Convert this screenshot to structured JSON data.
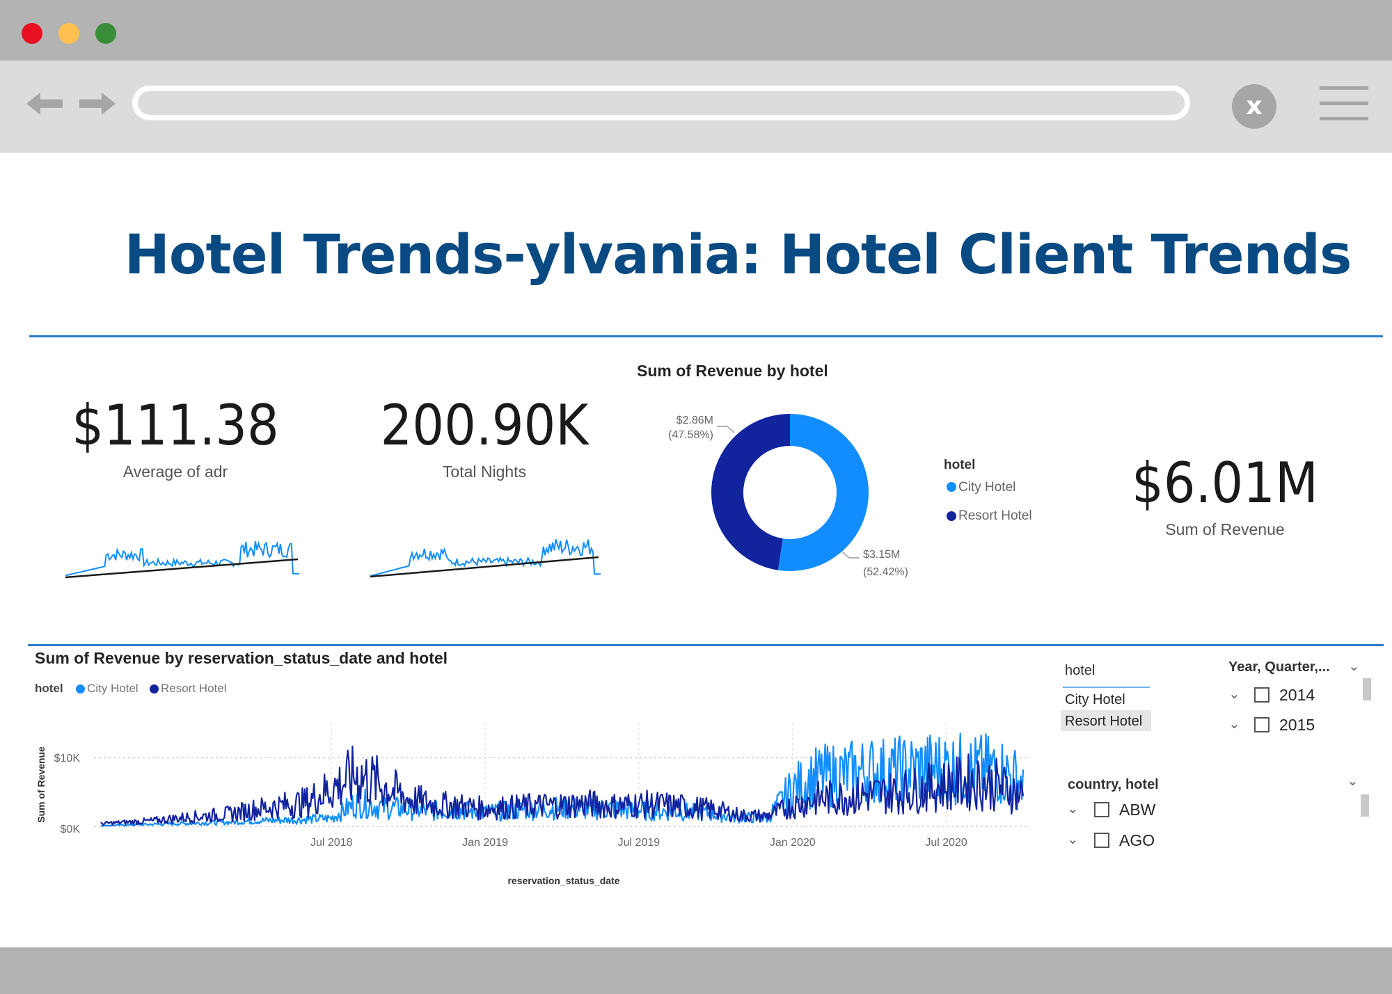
{
  "window": {
    "controls": {
      "close_color": "#e81123",
      "minimize_color": "#ffc14d",
      "maximize_color": "#3a8e3a"
    },
    "close_button_label": "x"
  },
  "dashboard": {
    "title": "Hotel Trends-ylvania: Hotel Client Trends",
    "accent_color": "#0a4a82"
  },
  "kpis": {
    "adr": {
      "value": "$111.38",
      "label": "Average of adr"
    },
    "nights": {
      "value": "200.90K",
      "label": "Total Nights"
    },
    "revenue": {
      "value": "$6.01M",
      "label": "Sum of Revenue"
    }
  },
  "donut": {
    "title": "Sum of Revenue by hotel",
    "legend_title": "hotel",
    "slices": [
      {
        "name": "City Hotel",
        "value_label": "$3.15M",
        "pct_label": "(52.42%)",
        "share": 0.5242,
        "color": "#118dff"
      },
      {
        "name": "Resort Hotel",
        "value_label": "$2.86M",
        "pct_label": "(47.58%)",
        "share": 0.4758,
        "color": "#12239e"
      }
    ]
  },
  "chart_data": {
    "type": "line",
    "title": "Sum of Revenue by reservation_status_date and hotel",
    "xlabel": "reservation_status_date",
    "ylabel": "Sum of Revenue",
    "legend_title": "hotel",
    "x_ticks": [
      "Jul 2018",
      "Jan 2019",
      "Jul 2019",
      "Jan 2020",
      "Jul 2020"
    ],
    "y_ticks": [
      "$0K",
      "$10K"
    ],
    "ylim": [
      0,
      15
    ],
    "legend_position": "top-left",
    "series": [
      {
        "name": "City Hotel",
        "color": "#118dff",
        "x": [
          "2017-10",
          "2017-11",
          "2017-12",
          "2018-01",
          "2018-02",
          "2018-03",
          "2018-04",
          "2018-05",
          "2018-06",
          "2018-07",
          "2018-08",
          "2018-09",
          "2018-10",
          "2018-11",
          "2018-12",
          "2019-01",
          "2019-02",
          "2019-03",
          "2019-04",
          "2019-05",
          "2019-06",
          "2019-07",
          "2019-08",
          "2019-09",
          "2019-10",
          "2019-11",
          "2019-12",
          "2020-01",
          "2020-02",
          "2020-03",
          "2020-04",
          "2020-05",
          "2020-06",
          "2020-07",
          "2020-08",
          "2020-09",
          "2020-10"
        ],
        "values": [
          0.1,
          0.2,
          0.3,
          0.4,
          0.5,
          0.6,
          0.8,
          0.9,
          1.0,
          1.2,
          3.5,
          2.8,
          2.5,
          2.2,
          2.4,
          2.0,
          2.3,
          2.6,
          2.7,
          2.5,
          2.6,
          2.3,
          2.2,
          2.1,
          1.8,
          1.3,
          1.2,
          5.5,
          7.2,
          7.6,
          8.1,
          8.0,
          8.4,
          8.6,
          8.2,
          8.3,
          6.5
        ]
      },
      {
        "name": "Resort Hotel",
        "color": "#12239e",
        "x": [
          "2017-10",
          "2017-11",
          "2017-12",
          "2018-01",
          "2018-02",
          "2018-03",
          "2018-04",
          "2018-05",
          "2018-06",
          "2018-07",
          "2018-08",
          "2018-09",
          "2018-10",
          "2018-11",
          "2018-12",
          "2019-01",
          "2019-02",
          "2019-03",
          "2019-04",
          "2019-05",
          "2019-06",
          "2019-07",
          "2019-08",
          "2019-09",
          "2019-10",
          "2019-11",
          "2019-12",
          "2020-01",
          "2020-02",
          "2020-03",
          "2020-04",
          "2020-05",
          "2020-06",
          "2020-07",
          "2020-08",
          "2020-09",
          "2020-10"
        ],
        "values": [
          0.4,
          0.6,
          0.8,
          1.2,
          1.5,
          1.8,
          2.5,
          3.0,
          3.5,
          5.5,
          7.5,
          6.0,
          4.0,
          3.2,
          3.0,
          2.6,
          2.8,
          3.0,
          3.1,
          3.3,
          3.0,
          3.2,
          3.1,
          2.8,
          2.4,
          1.6,
          1.5,
          3.0,
          4.0,
          4.3,
          4.6,
          5.0,
          5.4,
          6.0,
          6.5,
          6.0,
          4.5
        ]
      }
    ]
  },
  "slicers": {
    "hotel": {
      "header": "hotel",
      "items": [
        "City Hotel",
        "Resort Hotel"
      ]
    },
    "date": {
      "header": "Year, Quarter,...",
      "items": [
        "2014",
        "2015"
      ]
    },
    "country": {
      "header": "country, hotel",
      "items": [
        "ABW",
        "AGO"
      ]
    }
  }
}
